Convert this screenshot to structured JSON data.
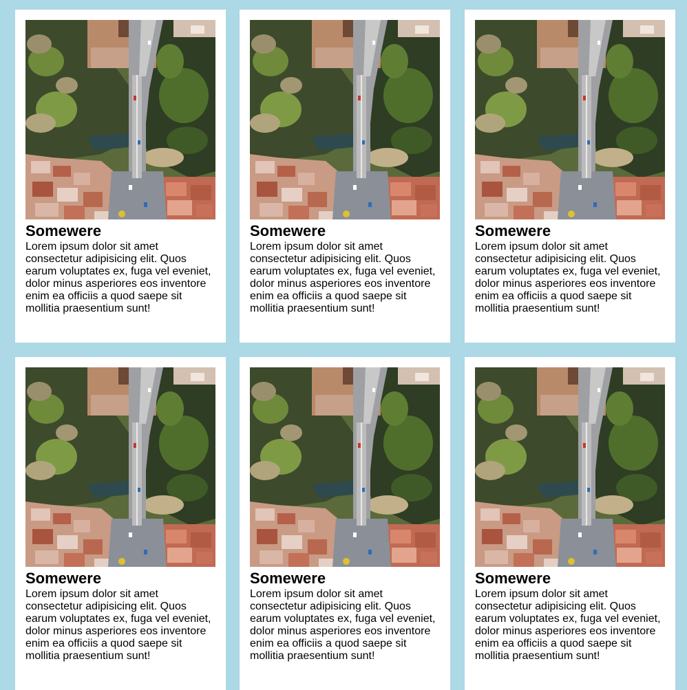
{
  "page": {
    "background_color": "#add8e6",
    "card_background": "#ffffff"
  },
  "cards": [
    {
      "image_alt": "aerial-bridge-photo",
      "title": "Somewere",
      "text": "Lorem ipsum dolor sit amet consectetur adipisicing elit. Quos earum voluptates ex, fuga vel eveniet, dolor minus asperiores eos inventore enim ea officiis a quod saepe sit mollitia praesentium sunt!"
    },
    {
      "image_alt": "aerial-bridge-photo",
      "title": "Somewere",
      "text": "Lorem ipsum dolor sit amet consectetur adipisicing elit. Quos earum voluptates ex, fuga vel eveniet, dolor minus asperiores eos inventore enim ea officiis a quod saepe sit mollitia praesentium sunt!"
    },
    {
      "image_alt": "aerial-bridge-photo",
      "title": "Somewere",
      "text": "Lorem ipsum dolor sit amet consectetur adipisicing elit. Quos earum voluptates ex, fuga vel eveniet, dolor minus asperiores eos inventore enim ea officiis a quod saepe sit mollitia praesentium sunt!"
    },
    {
      "image_alt": "aerial-bridge-photo",
      "title": "Somewere",
      "text": "Lorem ipsum dolor sit amet consectetur adipisicing elit. Quos earum voluptates ex, fuga vel eveniet, dolor minus asperiores eos inventore enim ea officiis a quod saepe sit mollitia praesentium sunt!"
    },
    {
      "image_alt": "aerial-bridge-photo",
      "title": "Somewere",
      "text": "Lorem ipsum dolor sit amet consectetur adipisicing elit. Quos earum voluptates ex, fuga vel eveniet, dolor minus asperiores eos inventore enim ea officiis a quod saepe sit mollitia praesentium sunt!"
    },
    {
      "image_alt": "aerial-bridge-photo",
      "title": "Somewere",
      "text": "Lorem ipsum dolor sit amet consectetur adipisicing elit. Quos earum voluptates ex, fuga vel eveniet, dolor minus asperiores eos inventore enim ea officiis a quod saepe sit mollitia praesentium sunt!"
    }
  ]
}
